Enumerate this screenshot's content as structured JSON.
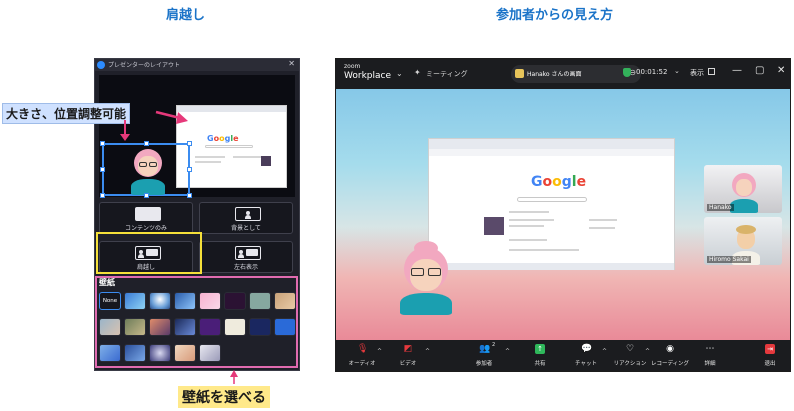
{
  "headings": {
    "left": "肩越し",
    "right": "参加者からの見え方"
  },
  "panel": {
    "title": "プレゼンターのレイアウト",
    "layout_buttons": [
      "コンテンツのみ",
      "背景として",
      "肩越し",
      "左右表示"
    ],
    "wallpaper_label": "壁紙",
    "wallpaper_none": "None"
  },
  "callouts": {
    "size_position": "大きさ、位置調整可能",
    "wallpaper": "壁紙を選べる"
  },
  "zoom": {
    "brand_line1": "zoom",
    "brand_line2": "Workplace",
    "meeting": "ミーティング",
    "share_title": "Hanako さんの画面",
    "timer": "00:01:52",
    "view": "表示",
    "window_controls": [
      "—",
      "▢",
      "✕"
    ],
    "google": "Google",
    "tiles": [
      {
        "name": "Hanako"
      },
      {
        "name": "Hiromo Sakai"
      }
    ],
    "toolbar": [
      {
        "label": "オーディオ",
        "icon": "mic-muted-icon"
      },
      {
        "label": "ビデオ",
        "icon": "video-muted-icon"
      },
      {
        "label": "参加者",
        "icon": "participants-icon",
        "count": "2"
      },
      {
        "label": "共有",
        "icon": "share-icon"
      },
      {
        "label": "チャット",
        "icon": "chat-icon"
      },
      {
        "label": "リアクション",
        "icon": "reaction-icon"
      },
      {
        "label": "レコーディング",
        "icon": "record-icon"
      },
      {
        "label": "詳細",
        "icon": "more-icon"
      },
      {
        "label": "退出",
        "icon": "leave-icon"
      }
    ]
  },
  "colors": {
    "highlight_yellow": "#f5e03a",
    "highlight_pink": "#e06bb0",
    "selection_blue": "#3b8cf0",
    "zoom_dark": "#1b1c1f",
    "share_green": "#2fb85b",
    "leave_red": "#e5393d"
  }
}
